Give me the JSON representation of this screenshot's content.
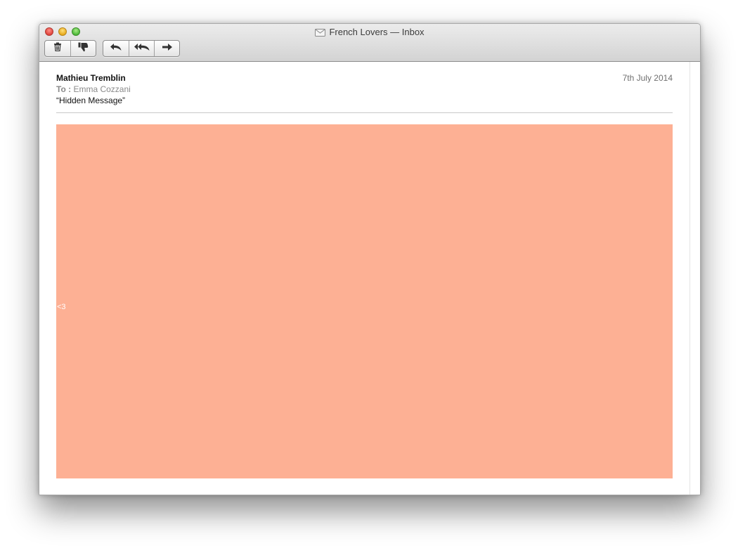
{
  "window": {
    "title": "French Lovers — Inbox",
    "title_icon": "envelope-icon"
  },
  "toolbar": {
    "delete_icon": "trash-icon",
    "junk_icon": "thumbs-down-icon",
    "reply_icon": "reply-arrow-icon",
    "reply_all_icon": "reply-all-arrow-icon",
    "forward_icon": "forward-arrow-icon"
  },
  "message": {
    "sender": "Mathieu Tremblin",
    "to_label": "To :",
    "to_value": " Emma Cozzani",
    "subject": "“Hidden Message”",
    "date": "7th July 2014",
    "body_text": "<3"
  },
  "colors": {
    "message_background": "#fdb094",
    "hidden_text": "#ffffff"
  }
}
